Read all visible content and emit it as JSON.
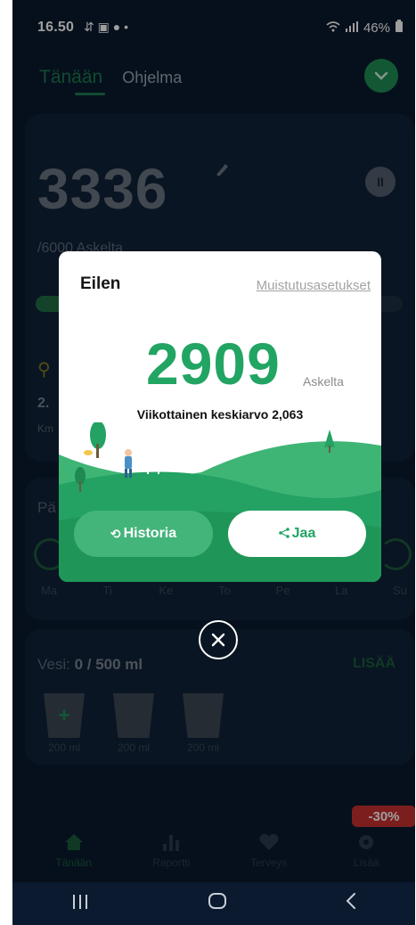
{
  "status_bar": {
    "time": "16.50",
    "left_icons": "⇵ ▣ ● •",
    "battery": "46%"
  },
  "tabs": {
    "today": "Tänään",
    "program": "Ohjelma"
  },
  "main_card": {
    "steps": "3336",
    "goal": "/6000 Askelta",
    "progress": 0.556,
    "distance": "2.",
    "distance_unit": "Km"
  },
  "week": {
    "title": "Pä",
    "days": [
      "Ma",
      "Ti",
      "Ke",
      "To",
      "Pe",
      "La",
      "Su"
    ]
  },
  "water": {
    "label": "Vesi:",
    "amount": "0 / 500 ml",
    "add": "LISÄÄ",
    "cups": [
      "200 ml",
      "200 ml",
      "200 ml"
    ]
  },
  "bottom_nav": {
    "items": [
      "Tänään",
      "Raportti",
      "Terveys",
      "Lisää"
    ],
    "promo": "-30%"
  },
  "modal": {
    "title": "Eilen",
    "reminder_link": "Muistutusasetukset",
    "steps": "2909",
    "steps_unit": "Askelta",
    "weekly_avg": "Viikottainen keskiarvo 2,063",
    "history_button": "Historia",
    "share_button": "Jaa"
  },
  "colors": {
    "accent": "#22a463",
    "accent_light": "#43b47a",
    "background": "#0b1a2e",
    "promo": "#c8312f"
  }
}
